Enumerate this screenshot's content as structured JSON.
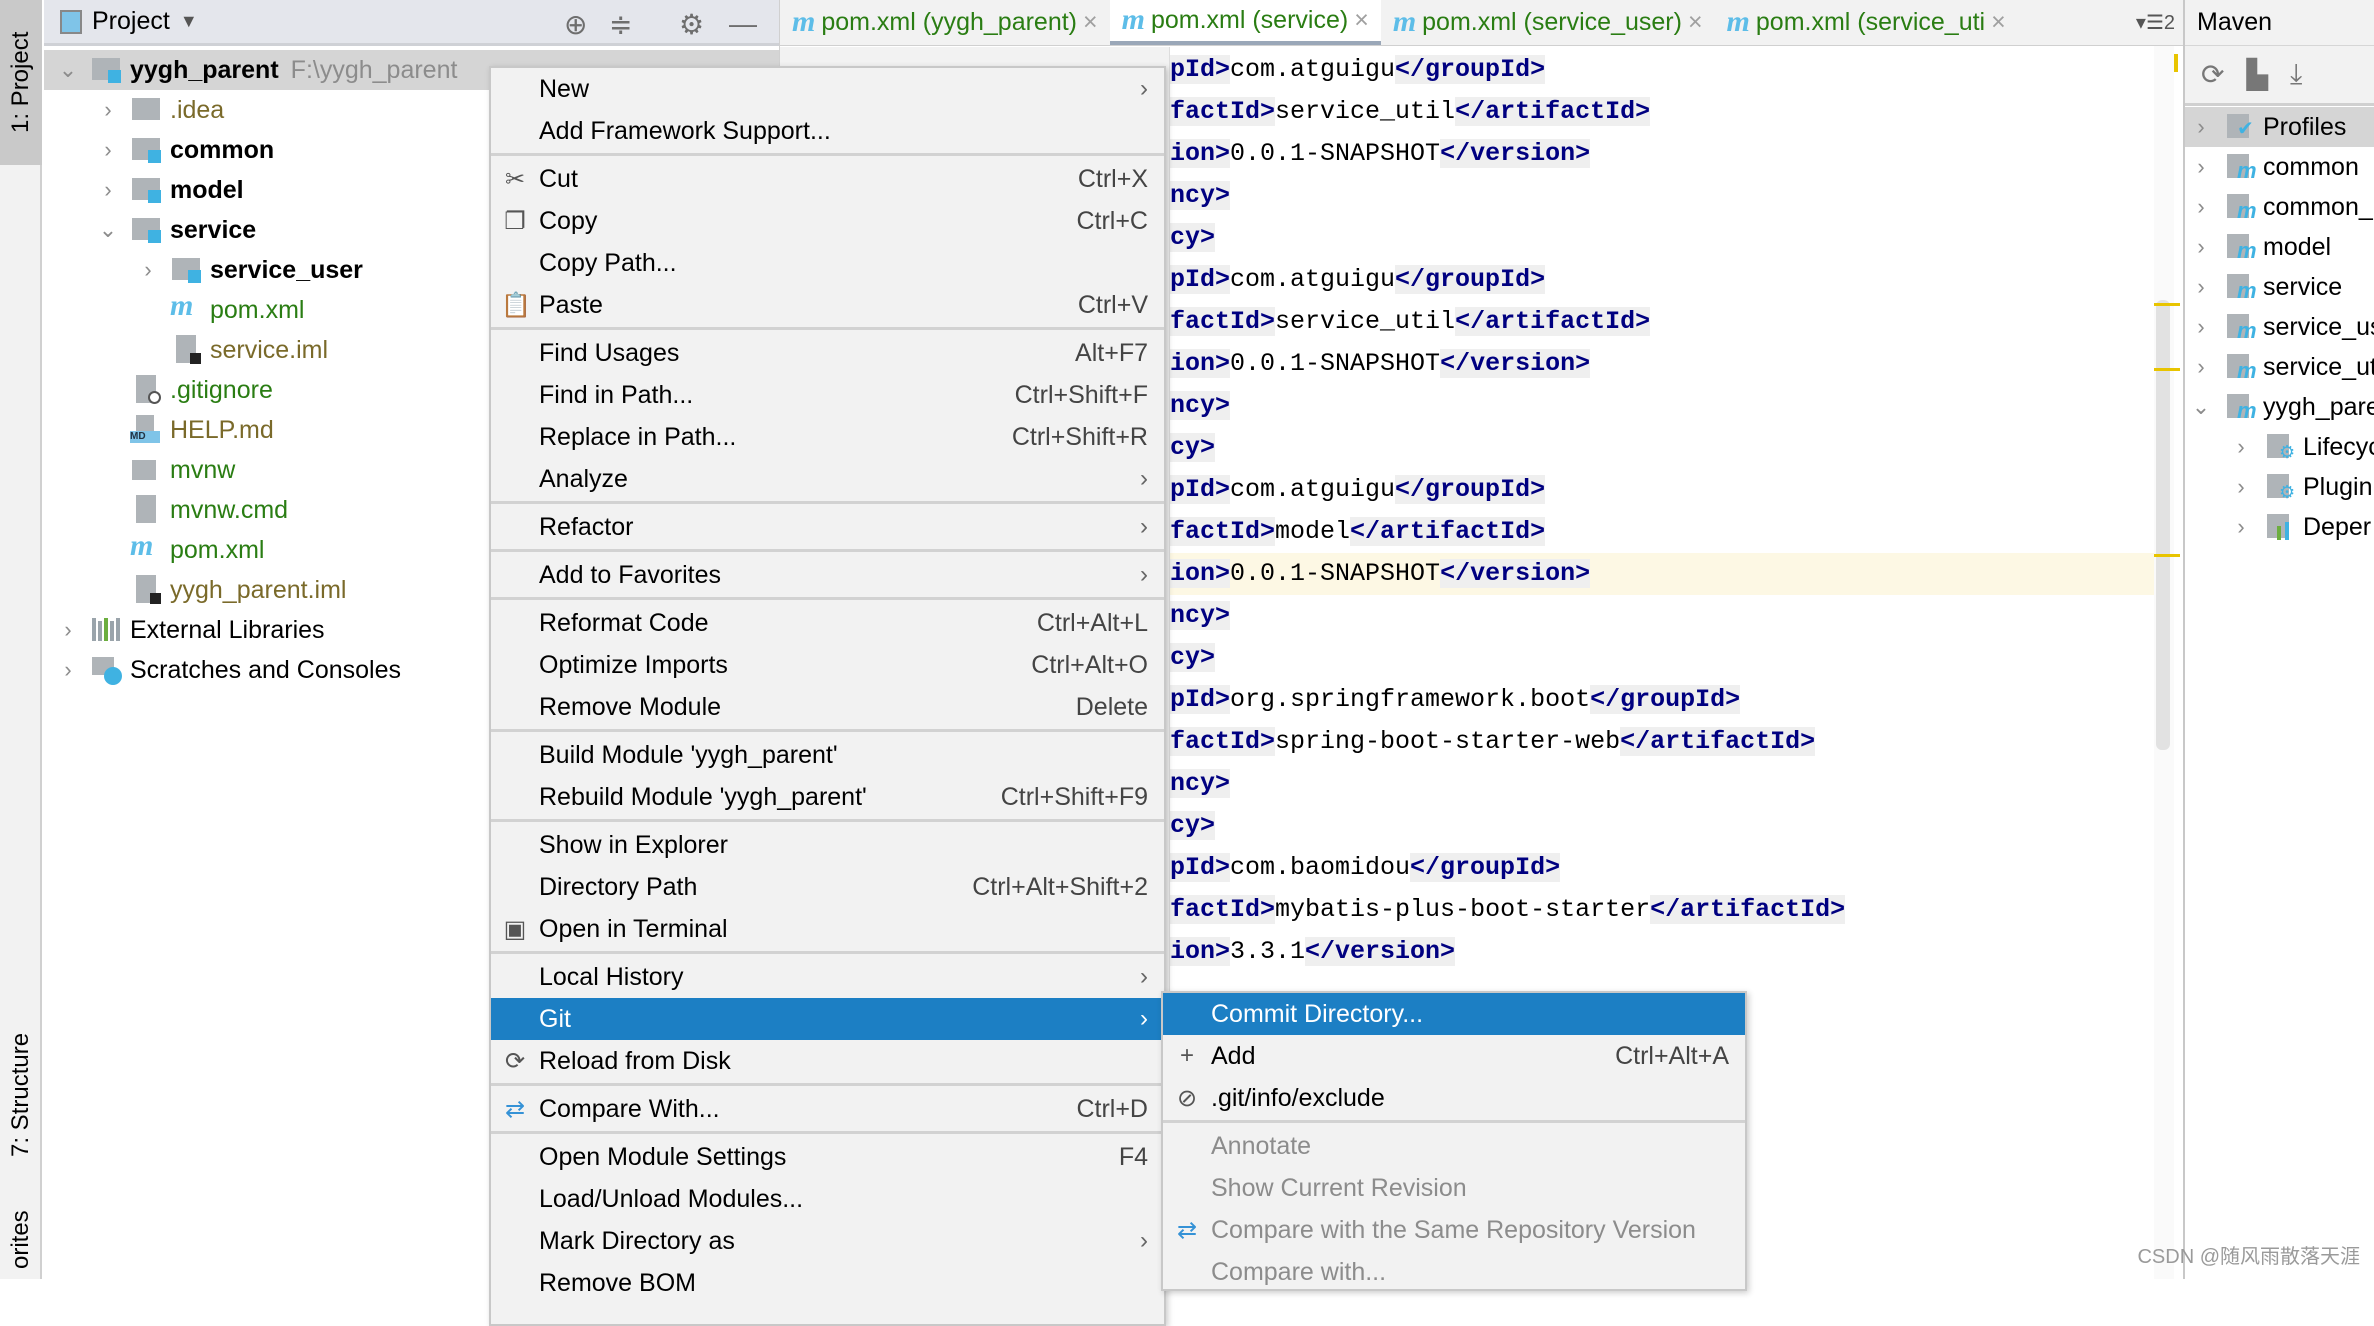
{
  "left_strip": {
    "project_tab": "1: Project",
    "structure_tab": "7: Structure",
    "favorites_tab": "orites"
  },
  "project_panel": {
    "title": "Project",
    "tree": [
      {
        "label": "yygh_parent",
        "path": "F:\\yygh_parent",
        "depth": 0,
        "chevron": "down",
        "icon": "module-folder",
        "color": "#000000",
        "bold": true,
        "selected": true
      },
      {
        "label": ".idea",
        "depth": 1,
        "chevron": "right",
        "icon": "folder",
        "color": "#7a6a2a"
      },
      {
        "label": "common",
        "depth": 1,
        "chevron": "right",
        "icon": "module-folder",
        "color": "#000000",
        "bold": true
      },
      {
        "label": "model",
        "depth": 1,
        "chevron": "right",
        "icon": "module-folder",
        "color": "#000000",
        "bold": true
      },
      {
        "label": "service",
        "depth": 1,
        "chevron": "down",
        "icon": "module-folder",
        "color": "#000000",
        "bold": true
      },
      {
        "label": "service_user",
        "depth": 2,
        "chevron": "right",
        "icon": "module-folder",
        "color": "#000000",
        "bold": true
      },
      {
        "label": "pom.xml",
        "depth": 2,
        "icon": "maven",
        "color": "#2a7d13"
      },
      {
        "label": "service.iml",
        "depth": 2,
        "icon": "iml",
        "color": "#7a6a2a"
      },
      {
        "label": ".gitignore",
        "depth": 1,
        "icon": "ignore",
        "color": "#2a7d13"
      },
      {
        "label": "HELP.md",
        "depth": 1,
        "icon": "markdown",
        "color": "#7a6a2a"
      },
      {
        "label": "mvnw",
        "depth": 1,
        "icon": "shell",
        "color": "#2a7d13"
      },
      {
        "label": "mvnw.cmd",
        "depth": 1,
        "icon": "text",
        "color": "#2a7d13"
      },
      {
        "label": "pom.xml",
        "depth": 1,
        "icon": "maven",
        "color": "#2a7d13"
      },
      {
        "label": "yygh_parent.iml",
        "depth": 1,
        "icon": "iml",
        "color": "#7a6a2a"
      },
      {
        "label": "External Libraries",
        "depth": 0,
        "chevron": "right",
        "icon": "libraries",
        "color": "#000000"
      },
      {
        "label": "Scratches and Consoles",
        "depth": 0,
        "chevron": "right",
        "icon": "scratches",
        "color": "#000000"
      }
    ]
  },
  "editor": {
    "tabs": [
      {
        "label": "pom.xml (yygh_parent)",
        "active": false
      },
      {
        "label": "pom.xml (service)",
        "active": true
      },
      {
        "label": "pom.xml (service_user)",
        "active": false
      },
      {
        "label": "pom.xml (service_uti",
        "active": false
      }
    ],
    "tab_overflow": "2",
    "highlighted_line": 12,
    "lines": [
      {
        "open": "pId>",
        "value": "com.atguigu",
        "close": "</groupId>"
      },
      {
        "open": "factId>",
        "value": "service_util",
        "close": "</artifactId>"
      },
      {
        "open": "ion>",
        "value": "0.0.1-SNAPSHOT",
        "close": "</version>"
      },
      {
        "open": "ncy>"
      },
      {
        "open": "cy>"
      },
      {
        "open": "pId>",
        "value": "com.atguigu",
        "close": "</groupId>"
      },
      {
        "open": "factId>",
        "value": "service_util",
        "close": "</artifactId>"
      },
      {
        "open": "ion>",
        "value": "0.0.1-SNAPSHOT",
        "close": "</version>"
      },
      {
        "open": "ncy>"
      },
      {
        "open": "cy>"
      },
      {
        "open": "pId>",
        "value": "com.atguigu",
        "close": "</groupId>"
      },
      {
        "open": "factId>",
        "value": "model",
        "close": "</artifactId>"
      },
      {
        "open": "ion>",
        "value": "0.0.1-SNAPSHOT",
        "close": "</version>"
      },
      {
        "open": "ncy>"
      },
      {
        "open": "cy>"
      },
      {
        "open": "pId>",
        "value": "org.springframework.boot",
        "close": "</groupId>"
      },
      {
        "open": "factId>",
        "value": "spring-boot-starter-web",
        "close": "</artifactId>"
      },
      {
        "open": "ncy>"
      },
      {
        "open": "cy>"
      },
      {
        "open": "pId>",
        "value": "com.baomidou",
        "close": "</groupId>"
      },
      {
        "open": "factId>",
        "value": "mybatis-plus-boot-starter",
        "close": "</artifactId>"
      },
      {
        "open": "ion>",
        "value": "3.3.1",
        "close": "</version>"
      }
    ]
  },
  "context_menu": {
    "groups": [
      [
        {
          "label": "New",
          "submenu": true
        },
        {
          "label": "Add Framework Support..."
        }
      ],
      [
        {
          "label": "Cut",
          "shortcut": "Ctrl+X",
          "icon": "scissors"
        },
        {
          "label": "Copy",
          "shortcut": "Ctrl+C",
          "icon": "copy"
        },
        {
          "label": "Copy Path..."
        },
        {
          "label": "Paste",
          "shortcut": "Ctrl+V",
          "icon": "clipboard"
        }
      ],
      [
        {
          "label": "Find Usages",
          "shortcut": "Alt+F7"
        },
        {
          "label": "Find in Path...",
          "shortcut": "Ctrl+Shift+F"
        },
        {
          "label": "Replace in Path...",
          "shortcut": "Ctrl+Shift+R"
        },
        {
          "label": "Analyze",
          "submenu": true
        }
      ],
      [
        {
          "label": "Refactor",
          "submenu": true
        }
      ],
      [
        {
          "label": "Add to Favorites",
          "submenu": true
        }
      ],
      [
        {
          "label": "Reformat Code",
          "shortcut": "Ctrl+Alt+L"
        },
        {
          "label": "Optimize Imports",
          "shortcut": "Ctrl+Alt+O"
        },
        {
          "label": "Remove Module",
          "shortcut": "Delete"
        }
      ],
      [
        {
          "label": "Build Module 'yygh_parent'"
        },
        {
          "label": "Rebuild Module 'yygh_parent'",
          "shortcut": "Ctrl+Shift+F9"
        }
      ],
      [
        {
          "label": "Show in Explorer"
        },
        {
          "label": "Directory Path",
          "shortcut": "Ctrl+Alt+Shift+2"
        },
        {
          "label": "Open in Terminal",
          "icon": "terminal"
        }
      ],
      [
        {
          "label": "Local History",
          "submenu": true
        },
        {
          "label": "Git",
          "submenu": true,
          "highlighted": true
        },
        {
          "label": "Reload from Disk",
          "icon": "reload"
        }
      ],
      [
        {
          "label": "Compare With...",
          "shortcut": "Ctrl+D",
          "icon": "compare"
        }
      ],
      [
        {
          "label": "Open Module Settings",
          "shortcut": "F4"
        },
        {
          "label": "Load/Unload Modules..."
        },
        {
          "label": "Mark Directory as",
          "submenu": true
        },
        {
          "label": "Remove BOM"
        }
      ]
    ]
  },
  "git_submenu": {
    "groups": [
      [
        {
          "label": "Commit Directory...",
          "highlighted": true
        },
        {
          "label": "Add",
          "shortcut": "Ctrl+Alt+A",
          "icon": "plus"
        },
        {
          "label": ".git/info/exclude",
          "icon": "ignore-file"
        }
      ],
      [
        {
          "label": "Annotate",
          "disabled": true
        },
        {
          "label": "Show Current Revision",
          "disabled": true
        },
        {
          "label": "Compare with the Same Repository Version",
          "disabled": true,
          "icon": "compare"
        },
        {
          "label": "Compare with...",
          "disabled": true
        }
      ]
    ]
  },
  "maven_panel": {
    "title": "Maven",
    "tree": [
      {
        "label": "Profiles",
        "depth": 0,
        "chevron": "right",
        "icon": "profiles",
        "selected": true
      },
      {
        "label": "common",
        "depth": 0,
        "chevron": "right",
        "icon": "maven-module"
      },
      {
        "label": "common_",
        "depth": 0,
        "chevron": "right",
        "icon": "maven-module"
      },
      {
        "label": "model",
        "depth": 0,
        "chevron": "right",
        "icon": "maven-module"
      },
      {
        "label": "service",
        "depth": 0,
        "chevron": "right",
        "icon": "maven-module"
      },
      {
        "label": "service_us",
        "depth": 0,
        "chevron": "right",
        "icon": "maven-module"
      },
      {
        "label": "service_ut",
        "depth": 0,
        "chevron": "right",
        "icon": "maven-module"
      },
      {
        "label": "yygh_pare",
        "depth": 0,
        "chevron": "down",
        "icon": "maven-module"
      },
      {
        "label": "Lifecyc",
        "depth": 1,
        "chevron": "right",
        "icon": "lifecycle"
      },
      {
        "label": "Plugin",
        "depth": 1,
        "chevron": "right",
        "icon": "plugins"
      },
      {
        "label": "Deper",
        "depth": 1,
        "chevron": "right",
        "icon": "dependencies"
      }
    ]
  },
  "watermark": "CSDN @随风雨散落天涯",
  "colors": {
    "selection": "#1c7fc4",
    "xml_tag": "#000080",
    "vcs_added": "#2a7d13",
    "caret_row": "#fdf8e4",
    "warning": "#e8c400"
  }
}
